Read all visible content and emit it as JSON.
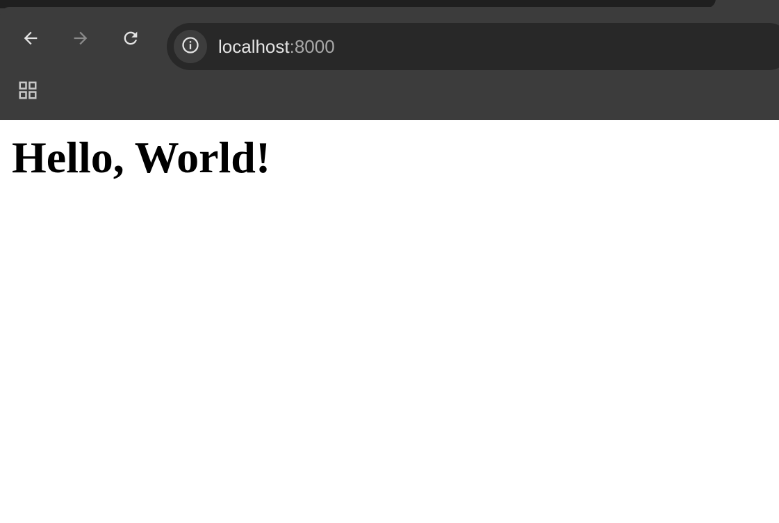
{
  "browser": {
    "address_bar": {
      "host": "localhost",
      "port": ":8000"
    },
    "icons": {
      "back": "back-arrow-icon",
      "forward": "forward-arrow-icon",
      "reload": "reload-icon",
      "site_info": "info-icon",
      "apps": "apps-grid-icon"
    },
    "colors": {
      "chrome_bg": "#3c3c3c",
      "omnibox_bg": "#282828",
      "tab_strip_bg": "#1f1f1f",
      "page_bg": "#ffffff"
    }
  },
  "page": {
    "heading": "Hello, World!"
  }
}
